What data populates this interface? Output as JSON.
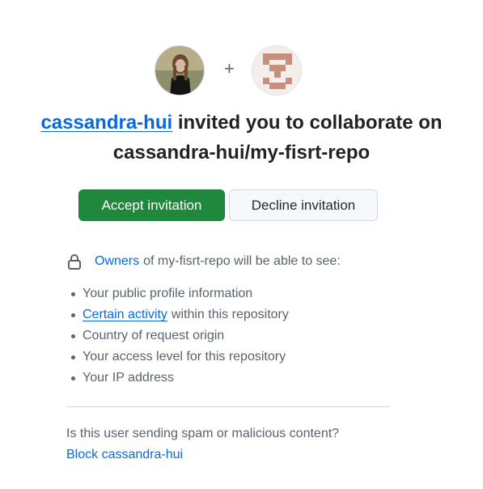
{
  "avatars": {
    "plus_sign": "+",
    "inviter_icon": "user-avatar-photo",
    "repo_icon": "identicon"
  },
  "invite": {
    "inviter": "cassandra-hui",
    "middle_text": " invited you to collaborate on",
    "repository": "cassandra-hui/my-fisrt-repo"
  },
  "actions": {
    "accept_label": "Accept invitation",
    "decline_label": "Decline invitation"
  },
  "permissions": {
    "owners_link": "Owners",
    "owners_suffix": "of my-fisrt-repo will be able to see:",
    "items": [
      {
        "text": "Your public profile information"
      },
      {
        "link": "Certain activity",
        "text": "within this repository"
      },
      {
        "text": "Country of request origin"
      },
      {
        "text": "Your access level for this repository"
      },
      {
        "text": "Your IP address"
      }
    ]
  },
  "spam": {
    "question": "Is this user sending spam or malicious content?",
    "block_link": "Block cassandra-hui"
  },
  "colors": {
    "accent_link": "#0969da",
    "accept_bg": "#1f883d",
    "muted_text": "#59636e",
    "identicon": "#c98f7d"
  }
}
